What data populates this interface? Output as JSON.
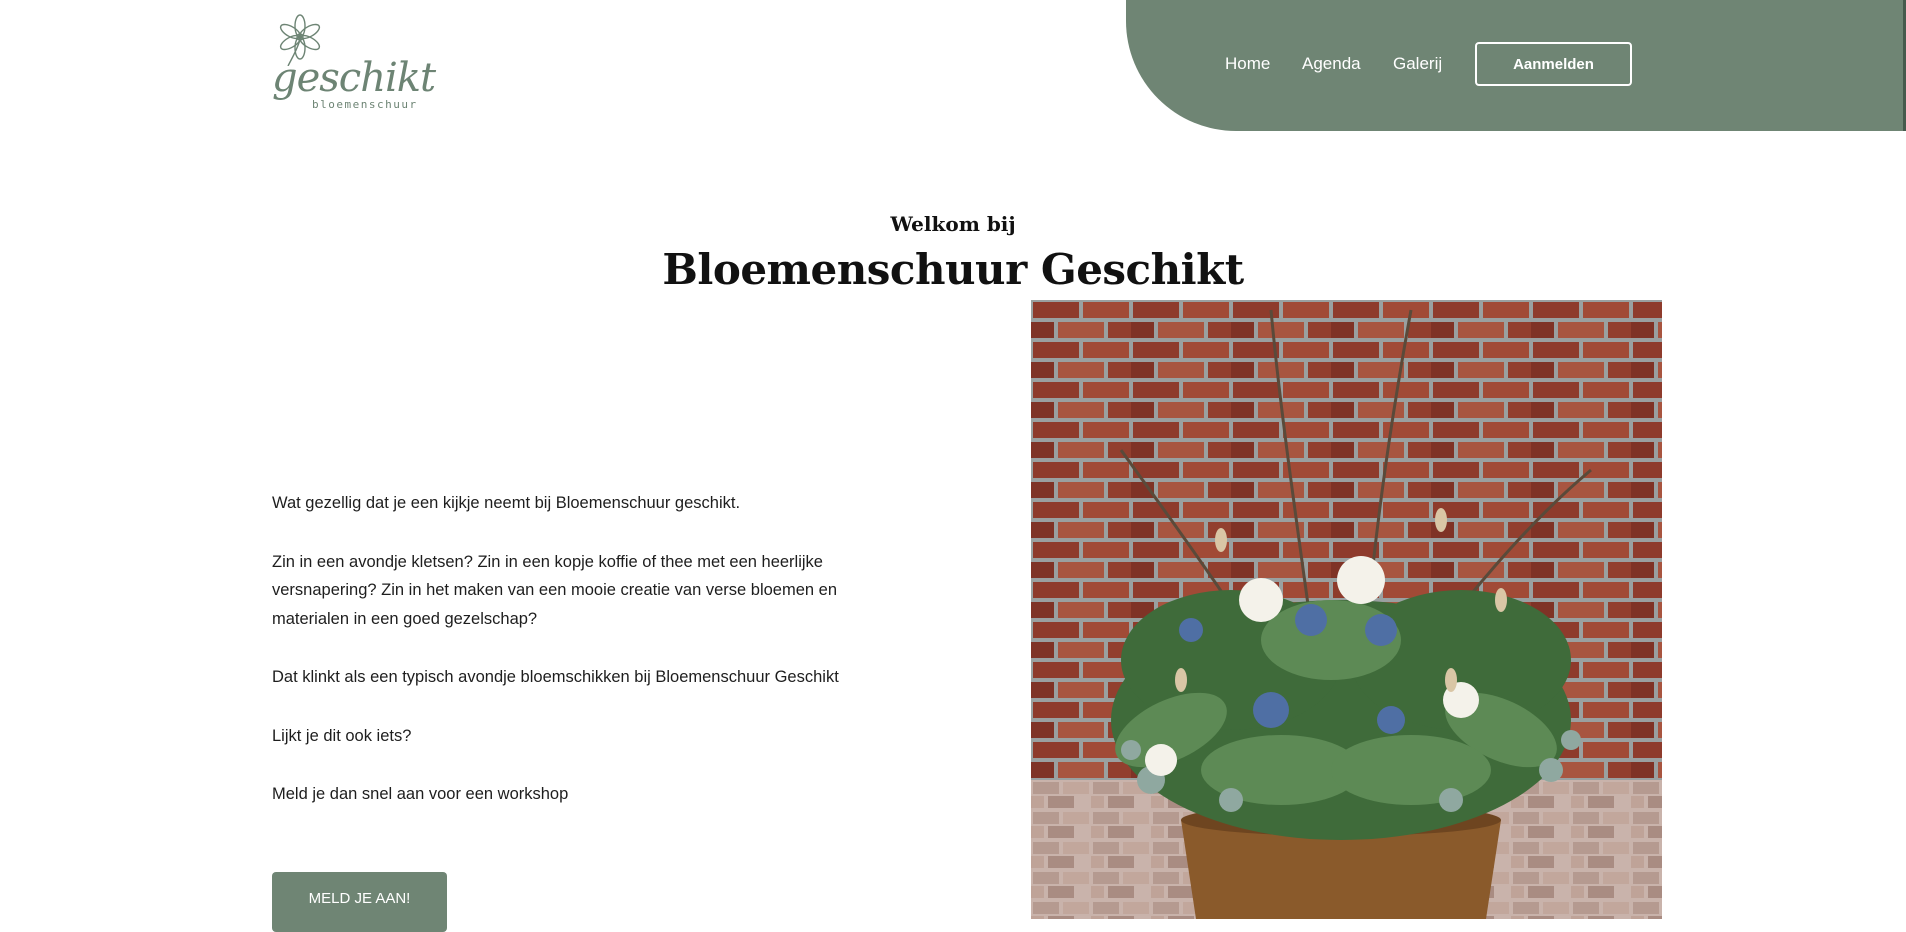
{
  "brand": {
    "name": "geschikt",
    "tagline": "bloemenschuur",
    "logo_icon": "flower-icon"
  },
  "nav": {
    "items": [
      {
        "label": "Home"
      },
      {
        "label": "Agenda"
      },
      {
        "label": "Galerij"
      }
    ],
    "cta_label": "Aanmelden"
  },
  "hero": {
    "welcome": "Welkom bij",
    "title": "Bloemenschuur Geschikt"
  },
  "intro": {
    "paragraphs": [
      "Wat gezellig dat je een kijkje neemt bij Bloemenschuur geschikt.",
      "Zin in een avondje kletsen? Zin in een kopje koffie of thee met een heerlijke versnapering? Zin in het maken van een mooie creatie van verse bloemen en materialen in een goed gezelschap?",
      "Dat klinkt als een typisch avondje bloemschikken bij Bloemenschuur Geschikt",
      "Lijkt je dit ook iets?",
      "Meld je dan snel aan voor een workshop"
    ],
    "button_label": "MELD JE AAN!"
  },
  "colors": {
    "accent": "#6f8574",
    "text": "#1e1e1e",
    "background": "#ffffff"
  }
}
